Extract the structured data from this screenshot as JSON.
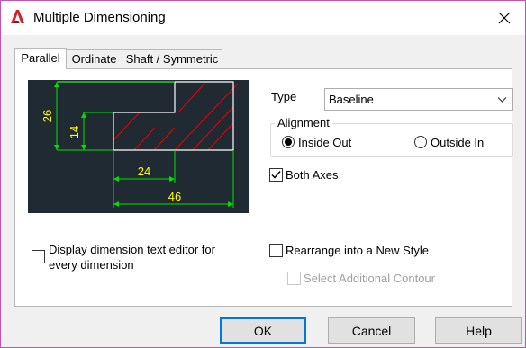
{
  "window": {
    "title": "Multiple Dimensioning",
    "app_icon": "autocad-a-icon",
    "close_icon": "close-icon"
  },
  "tabs": [
    {
      "label": "Parallel",
      "active": true
    },
    {
      "label": "Ordinate",
      "active": false
    },
    {
      "label": "Shaft / Symmetric",
      "active": false
    }
  ],
  "preview": {
    "dim_26": "26",
    "dim_14": "14",
    "dim_24": "24",
    "dim_46": "46",
    "colors": {
      "background": "#202a33",
      "dimension": "#00e000",
      "text": "#ffff00",
      "hatch": "#e00000",
      "outline": "#ffffff"
    }
  },
  "type": {
    "label": "Type",
    "selected": "Baseline"
  },
  "alignment": {
    "title": "Alignment",
    "options": [
      {
        "label": "Inside Out",
        "selected": true
      },
      {
        "label": "Outside In",
        "selected": false
      }
    ]
  },
  "both_axes": {
    "label": "Both Axes",
    "checked": true
  },
  "display_editor": {
    "label_line1": "Display dimension text editor for",
    "label_line2": "every dimension",
    "checked": false
  },
  "rearrange": {
    "label": "Rearrange into a New Style",
    "checked": false
  },
  "select_contour": {
    "label": "Select Additional Contour",
    "checked": false,
    "enabled": false
  },
  "buttons": {
    "ok": "OK",
    "cancel": "Cancel",
    "help": "Help"
  },
  "accent_color": "#0078d7"
}
